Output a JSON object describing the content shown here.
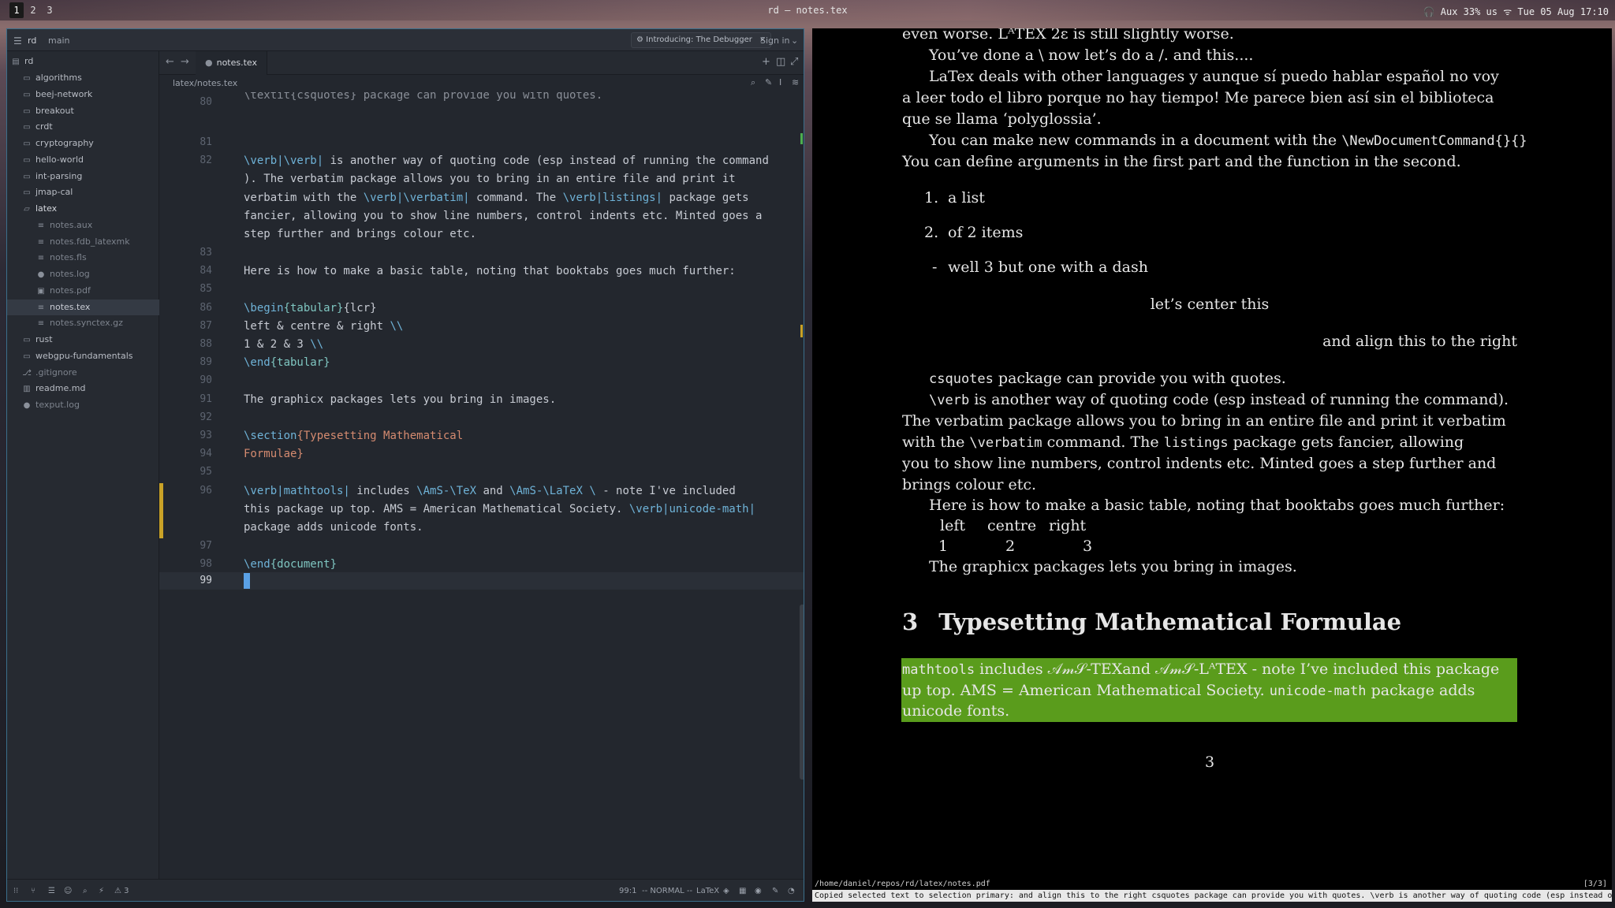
{
  "topbar": {
    "workspaces": [
      "1",
      "2",
      "3"
    ],
    "active_workspace": "1",
    "window_title": "rd — notes.tex",
    "status": "🎧 Aux 33% us ᯤ Tue 05 Aug 17:10"
  },
  "editor": {
    "project": "rd",
    "branch": "main",
    "announcement": "Introducing: The Debugger",
    "sign_in": "Sign in",
    "tab_title": "notes.tex",
    "breadcrumb": "latex/notes.tex",
    "tree": [
      {
        "label": "rd",
        "type": "root"
      },
      {
        "label": "algorithms",
        "type": "folder"
      },
      {
        "label": "beej-network",
        "type": "folder"
      },
      {
        "label": "breakout",
        "type": "folder"
      },
      {
        "label": "crdt",
        "type": "folder"
      },
      {
        "label": "cryptography",
        "type": "folder"
      },
      {
        "label": "hello-world",
        "type": "folder"
      },
      {
        "label": "int-parsing",
        "type": "folder"
      },
      {
        "label": "jmap-cal",
        "type": "folder"
      },
      {
        "label": "latex",
        "type": "folder-open"
      },
      {
        "label": "notes.aux",
        "type": "file"
      },
      {
        "label": "notes.fdb_latexmk",
        "type": "file"
      },
      {
        "label": "notes.fls",
        "type": "file"
      },
      {
        "label": "notes.log",
        "type": "file"
      },
      {
        "label": "notes.pdf",
        "type": "file"
      },
      {
        "label": "notes.tex",
        "type": "file",
        "selected": true
      },
      {
        "label": "notes.synctex.gz",
        "type": "file"
      },
      {
        "label": "rust",
        "type": "folder"
      },
      {
        "label": "webgpu-fundamentals",
        "type": "folder"
      },
      {
        "label": ".gitignore",
        "type": "file"
      },
      {
        "label": "readme.md",
        "type": "file"
      },
      {
        "label": "texput.log",
        "type": "file"
      }
    ],
    "line_numbers": [
      "80",
      "81",
      "82",
      "83",
      "84",
      "85",
      "86",
      "87",
      "88",
      "89",
      "90",
      "91",
      "92",
      "93",
      "94",
      "95",
      "96",
      "97",
      "98",
      "99"
    ],
    "code": {
      "l80": "\\textit{csquotes} package can provide you with quotes.",
      "l82a_cmd": "\\verb|\\verb|",
      "l82a": " is another way of quoting code (esp instead of running the command",
      "l82b": "). The verbatim package allows you to bring in an entire file and print it",
      "l82c_pre": "verbatim with the ",
      "l82c_cmd": "\\verb|\\verbatim|",
      "l82c_mid": " command. The ",
      "l82c_cmd2": "\\verb|listings|",
      "l82c_post": " package gets",
      "l82d": "fancier, allowing you to show line numbers, control indents etc. Minted goes a",
      "l82e": "step further and brings colour etc.",
      "l84": "Here is how to make a basic table, noting that booktabs goes much further:",
      "l86_cmd": "\\begin",
      "l86_env": "{tabular}",
      "l86_rest": "{lcr}",
      "l87": "left & centre & right ",
      "l87_cmd": "\\\\",
      "l88": "1 & 2 & 3 ",
      "l88_cmd": "\\\\",
      "l89_cmd": "\\end",
      "l89_env": "{tabular}",
      "l91": "The graphicx packages lets you bring in images.",
      "l93_cmd": "\\section",
      "l93_arg": "{Typesetting Mathematical",
      "l94_arg": "Formulae}",
      "l96a_cmd": "\\verb|mathtools|",
      "l96a_mid": " includes ",
      "l96a_cmd2": "\\AmS-\\TeX",
      "l96a_and": " and ",
      "l96a_cmd3": "\\AmS-\\LaTeX",
      "l96a_cmd4": " \\ ",
      "l96a_post": "- note I've included",
      "l96b_pre": "this package up top. AMS = American Mathematical Society. ",
      "l96b_cmd": "\\verb|unicode-math|",
      "l96c": "package adds unicode fonts.",
      "l98_cmd": "\\end",
      "l98_env": "{document}"
    },
    "status": {
      "warnings": "3",
      "position": "99:1",
      "mode": "-- NORMAL --",
      "language": "LaTeX"
    }
  },
  "pdf": {
    "lines": {
      "p1": "even worse. LᴬTEX 2ε is still slightly worse.",
      "p2": "You’ve done a \\ now let’s do a /. and this....",
      "p3a": "LaTex deals with other languages y aunque sí puedo hablar español no voy",
      "p3b": "a leer todo el libro porque no hay tiempo! Me parece bien así sin el biblioteca",
      "p3c": "que se llama ‘polyglossia’.",
      "p4a_pre": "You can make new commands in a document with the ",
      "p4a_tt": "\\NewDocumentCommand{}{}",
      "p4b": "You can define arguments in the first part and the function in the second.",
      "list": [
        {
          "marker": "1.",
          "text": "a list"
        },
        {
          "marker": "2.",
          "text": "of 2 items"
        },
        {
          "marker": "-",
          "text": "well 3 but one with a dash"
        }
      ],
      "center": "let’s center this",
      "right": "and align this to the right",
      "p5_tt": "csquotes",
      "p5": " package can provide you with quotes.",
      "p6a_tt": "\\verb",
      "p6a": " is another way of quoting code (esp instead of running the command).",
      "p6b": "The verbatim package allows you to bring in an entire file and print it verbatim",
      "p6c_pre": "with the ",
      "p6c_tt": "\\verbatim",
      "p6c_mid": " command.  The ",
      "p6c_tt2": "listings",
      "p6c_post": " package gets fancier, allowing",
      "p6d": "you to show line numbers, control indents etc.  Minted goes a step further and",
      "p6e": "brings colour etc.",
      "p7": "Here is how to make a basic table, noting that booktabs goes much further:",
      "table_head": [
        "left",
        "centre",
        "right"
      ],
      "table_row": [
        "1",
        "2",
        "3"
      ],
      "p8": "The graphicx packages lets you bring in images.",
      "section_num": "3",
      "section_title": "Typesetting Mathematical Formulae",
      "h1_tt": "mathtools",
      "h1": " includes 𝒜𝓂𝒮-TEXand 𝒜𝓂𝒮-LᴬTEX - note I’ve included this package",
      "h2_pre": "up top.  AMS = American Mathematical Society. ",
      "h2_tt": "unicode-math",
      "h2_post": " package adds",
      "h3": "unicode fonts.",
      "page_number": "3"
    },
    "path": "/home/daniel/repos/rd/latex/notes.pdf",
    "pages": "[3/3]",
    "message": "Copied selected text to selection primary: and align this to the right csquotes package can provide you with quotes. \\verb is another way of quoting code (esp instead of running …"
  }
}
